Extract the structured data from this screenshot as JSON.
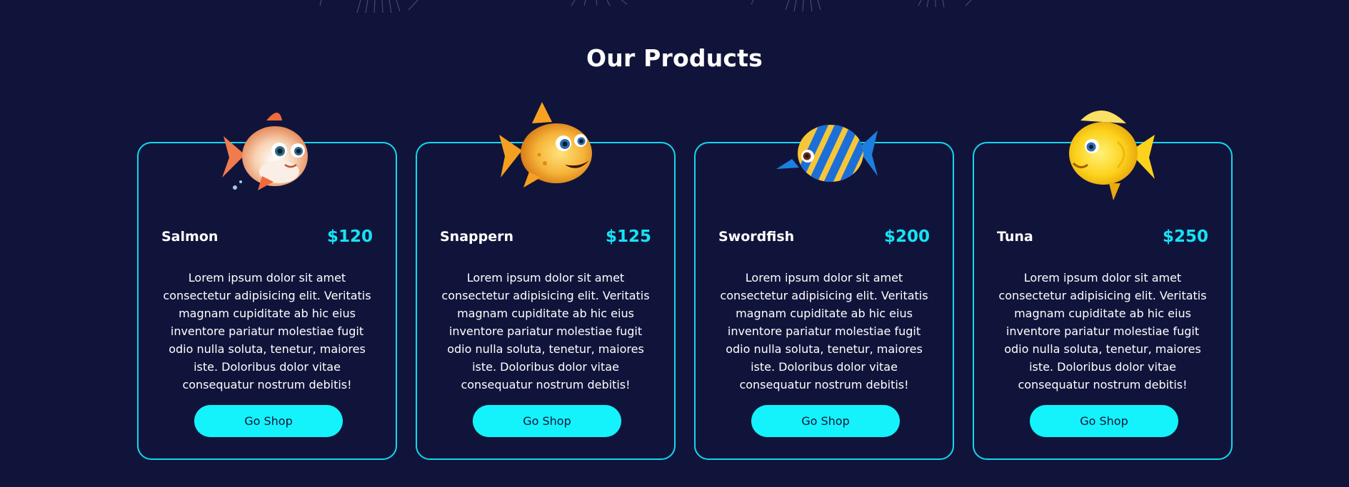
{
  "section": {
    "title": "Our Products"
  },
  "products": [
    {
      "name": "Salmon",
      "price": "$120",
      "description": "Lorem ipsum dolor sit amet consectetur adipisicing elit. Veritatis magnam cupiditate ab hic eius inventore pariatur molestiae fugit odio nulla soluta, tenetur, maiores iste. Doloribus dolor vitae consequatur nostrum debitis!",
      "button_label": "Go Shop",
      "icon": "salmon-fish-icon"
    },
    {
      "name": "Snappern",
      "price": "$125",
      "description": "Lorem ipsum dolor sit amet consectetur adipisicing elit. Veritatis magnam cupiditate ab hic eius inventore pariatur molestiae fugit odio nulla soluta, tenetur, maiores iste. Doloribus dolor vitae consequatur nostrum debitis!",
      "button_label": "Go Shop",
      "icon": "snapper-fish-icon"
    },
    {
      "name": "Swordfish",
      "price": "$200",
      "description": "Lorem ipsum dolor sit amet consectetur adipisicing elit. Veritatis magnam cupiditate ab hic eius inventore pariatur molestiae fugit odio nulla soluta, tenetur, maiores iste. Doloribus dolor vitae consequatur nostrum debitis!",
      "button_label": "Go Shop",
      "icon": "swordfish-icon"
    },
    {
      "name": "Tuna",
      "price": "$250",
      "description": "Lorem ipsum dolor sit amet consectetur adipisicing elit. Veritatis magnam cupiditate ab hic eius inventore pariatur molestiae fugit odio nulla soluta, tenetur, maiores iste. Doloribus dolor vitae consequatur nostrum debitis!",
      "button_label": "Go Shop",
      "icon": "tuna-fish-icon"
    }
  ],
  "colors": {
    "background": "#11143a",
    "accent": "#14f2fb",
    "card_border": "#13d7ee",
    "price": "#16e3f5",
    "text": "#ffffff"
  }
}
